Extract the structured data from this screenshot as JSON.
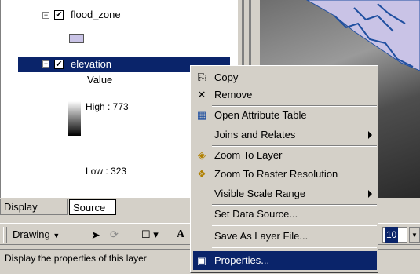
{
  "toc": {
    "flood_layer": {
      "label": "flood_zone",
      "checked": "✔",
      "expander": "−"
    },
    "elevation_layer": {
      "label": "elevation",
      "checked": "✔",
      "expander": "−"
    },
    "legend": {
      "field": "Value",
      "high": "High : 773",
      "low": "Low : 323"
    },
    "swatch_color": "#c9c3e6"
  },
  "tabs": [
    {
      "label": "Display"
    },
    {
      "label": "Source"
    }
  ],
  "toolbar": {
    "drawing_label": "Drawing",
    "font_size": "10",
    "text_tool": "A"
  },
  "status": {
    "text": "Display the properties of this layer"
  },
  "context_menu": {
    "items": [
      {
        "label": "Copy",
        "icon": "copy-icon",
        "glyph": "⎘"
      },
      {
        "label": "Remove",
        "icon": "remove-icon",
        "glyph": "✕"
      },
      {
        "label": "Open Attribute Table",
        "icon": "table-icon",
        "glyph": "▦"
      },
      {
        "label": "Joins and Relates",
        "icon": "",
        "glyph": "",
        "submenu": true
      },
      {
        "label": "Zoom To Layer",
        "icon": "zoom-layer-icon",
        "glyph": "◈"
      },
      {
        "label": "Zoom To Raster Resolution",
        "icon": "zoom-raster-icon",
        "glyph": "❖"
      },
      {
        "label": "Visible Scale Range",
        "icon": "",
        "glyph": "",
        "submenu": true
      },
      {
        "label": "Set Data Source...",
        "icon": "",
        "glyph": ""
      },
      {
        "label": "Save As Layer File...",
        "icon": "",
        "glyph": ""
      },
      {
        "label": "Properties...",
        "icon": "properties-icon",
        "glyph": "▣",
        "selected": true
      }
    ]
  },
  "colors": {
    "selection": "#0a246a",
    "chrome": "#d4d0c8"
  }
}
